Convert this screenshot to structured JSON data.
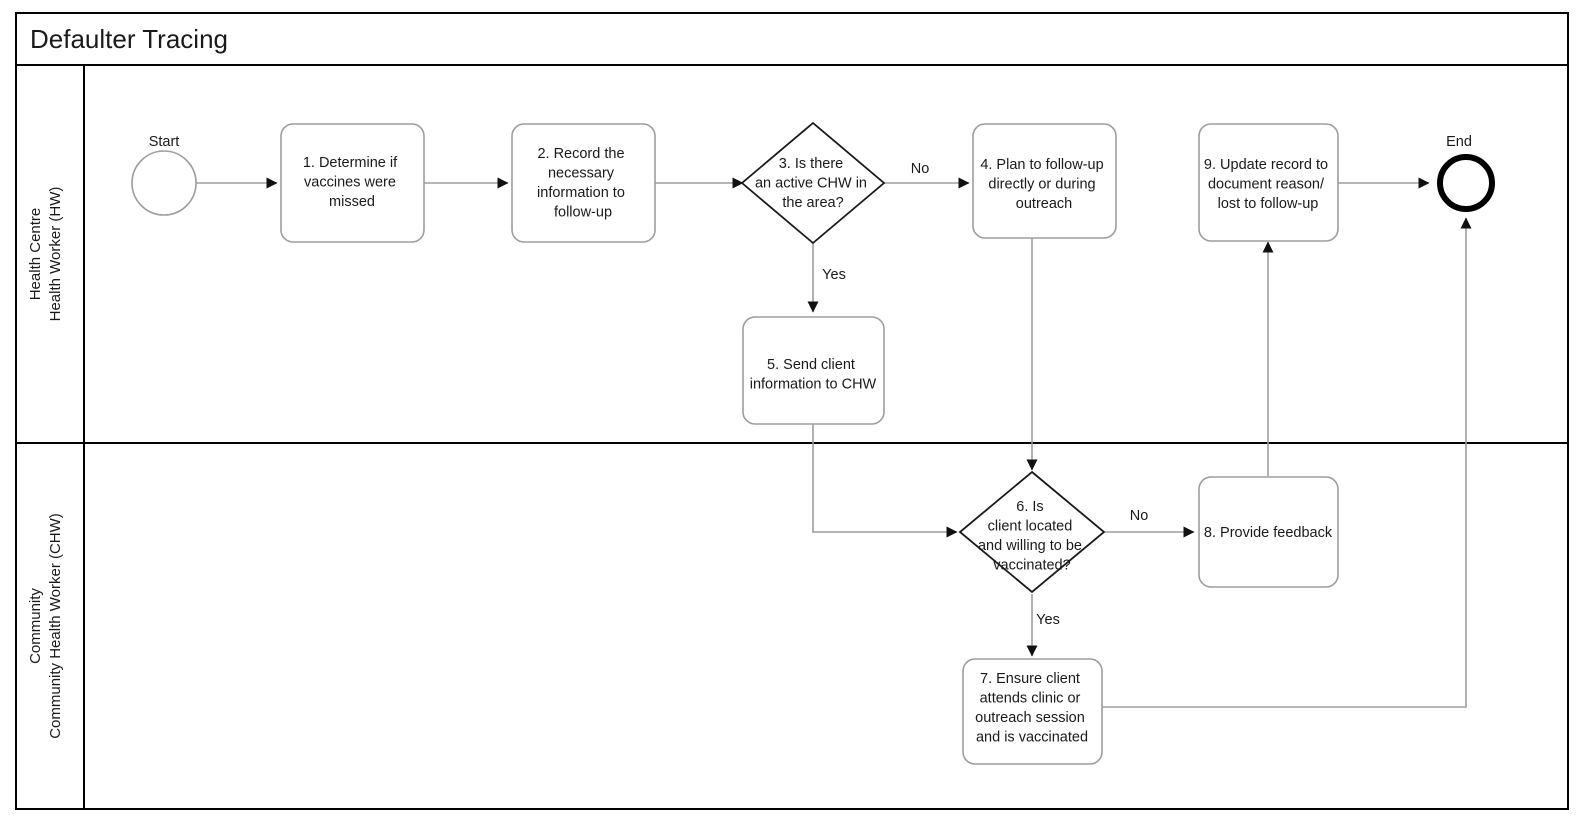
{
  "pool": {
    "title": "Defaulter Tracing",
    "lanes": [
      {
        "id": "lane-health-centre",
        "line1": "Health Centre",
        "line2": "Health Worker (HW)"
      },
      {
        "id": "lane-community",
        "line1": "Community",
        "line2": "Community Health Worker (CHW)"
      }
    ]
  },
  "events": {
    "start": {
      "label": "Start"
    },
    "end": {
      "label": "End"
    }
  },
  "nodes": {
    "task1": {
      "lines": [
        "1. Determine if",
        "vaccines were",
        "missed"
      ]
    },
    "task2": {
      "lines": [
        "2. Record the",
        "necessary",
        "information to",
        "follow-up"
      ]
    },
    "gateway3": {
      "lines": [
        "3. Is there",
        "an active CHW in",
        "the area?"
      ]
    },
    "task4": {
      "lines": [
        "4. Plan to follow-up",
        "directly or during",
        "outreach"
      ]
    },
    "task5": {
      "lines": [
        "5. Send client",
        "information to CHW"
      ]
    },
    "gateway6": {
      "lines": [
        "6. Is",
        "client located",
        "and willing to be",
        "vaccinated?"
      ]
    },
    "task7": {
      "lines": [
        "7. Ensure client",
        "attends clinic or",
        "outreach session",
        "and is vaccinated"
      ]
    },
    "task8": {
      "lines": [
        "8. Provide feedback"
      ]
    },
    "task9": {
      "lines": [
        "9. Update record to",
        "document reason/",
        "lost to follow-up"
      ]
    }
  },
  "flow_labels": {
    "g3_no": "No",
    "g3_yes": "Yes",
    "g6_no": "No",
    "g6_yes": "Yes"
  },
  "colors": {
    "frame": "#000000",
    "task_stroke": "#9d9d9d",
    "gateway_stroke": "#1a1a1a",
    "flow_stroke": "#9d9d9d",
    "text": "#1a1a1a",
    "background": "#ffffff"
  }
}
